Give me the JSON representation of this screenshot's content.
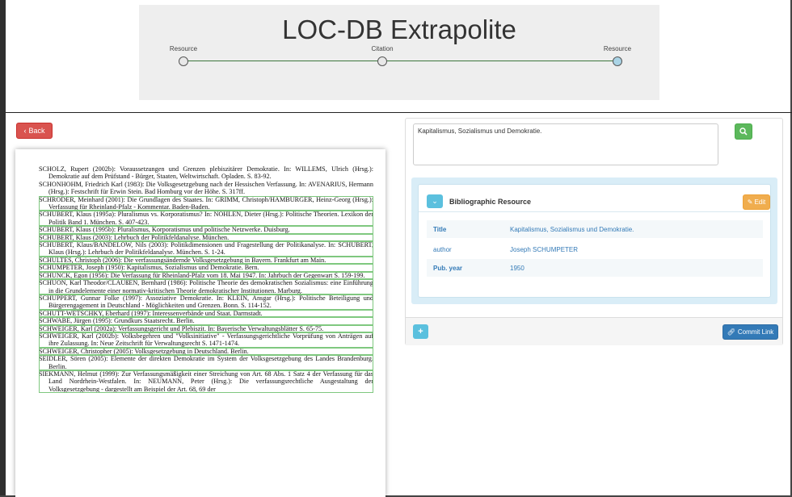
{
  "app": {
    "title": "LOC-DB Extrapolite"
  },
  "stepper": {
    "steps": [
      {
        "label": "Resource",
        "active": false
      },
      {
        "label": "Citation",
        "active": false
      },
      {
        "label": "Resource",
        "active": true
      }
    ]
  },
  "toolbar": {
    "back_label": "Back",
    "back_icon": "chevron-left"
  },
  "scan": {
    "references": [
      {
        "text": "SCHOLZ, Rupert (2002b): Voraussetzungen und Grenzen plebiszitärer Demokratie. In: WILLEMS, Ulrich (Hrsg.): Demokratie auf dem Prüfstand - Bürger, Staaten, Weltwirtschaft. Opladen. S. 83-92.",
        "highlighted": false
      },
      {
        "text": "SCHONHOHM, Friedrich Karl (1983): Die Volksgesetzgebung nach der Hessischen Verfassung. In: AVENARIUS, Hermann (Hrsg.): Festschrift für Erwin Stein. Bad Homburg vor der Höhe. S. 317ff.",
        "highlighted": false
      },
      {
        "text": "SCHRÖDER, Meinhard (2001): Die Grundlagen des Staates. In: GRIMM, Christoph/HAMBURGER, Heinz-Georg (Hrsg.): Verfassung für Rheinland-Pfalz - Kommentar. Baden-Baden.",
        "highlighted": true
      },
      {
        "text": "SCHUBERT, Klaus (1995a): Pluralismus vs. Korporatismus? In: NOHLEN, Dieter (Hrsg.): Politische Theorien. Lexikon der Politik Band 1. München. S. 407-423.",
        "highlighted": true
      },
      {
        "text": "SCHUBERT, Klaus (1995b): Pluralismus, Korporatismus und politische Netzwerke. Duisburg.",
        "highlighted": true
      },
      {
        "text": "SCHUBERT, Klaus (2003): Lehrbuch der Politikfeldanalyse. München.",
        "highlighted": true
      },
      {
        "text": "SCHUBERT, Klaus/BANDELOW, Nils (2003): Politikdimensionen und Fragestellung der Politikanalyse. In: SCHUBERT, Klaus (Hrsg.): Lehrbuch der Politikfeldanalyse. München. S. 1-24.",
        "highlighted": true
      },
      {
        "text": "SCHULTES, Christoph (2006): Die verfassungsändernde Volksgesetzgebung in Bayern. Frankfurt am Main.",
        "highlighted": true
      },
      {
        "text": "SCHUMPETER, Joseph (1950): Kapitalismus, Sozialismus und Demokratie. Bern.",
        "highlighted": true
      },
      {
        "text": "SCHUNCK, Egon (1956): Die Verfassung für Rheinland-Pfalz vom 18. Mai 1947. In: Jahrbuch der Gegenwart S. 159-199.",
        "highlighted": true
      },
      {
        "text": "SCHUON, Karl Theodor/CLAUßEN, Bernhard (1986): Politische Theorie des demokratischen Sozialismus: eine Einführung in die Grundelemente einer normativ-kritischen Theorie demokratischer Institutionen. Marburg.",
        "highlighted": true
      },
      {
        "text": "SCHUPPERT, Gunnar Folke (1997): Assoziative Demokratie. In: KLEIN, Ansgar (Hrsg.): Politische Beteiligung und Bürgerengagement in Deutschland - Möglichkeiten und Grenzen. Bonn. S. 114-152.",
        "highlighted": true
      },
      {
        "text": "SCHÜTT-WETSCHKY, Eberhard (1997): Interessenverbände und Staat. Darmstadt.",
        "highlighted": true
      },
      {
        "text": "SCHWABE, Jürgen (1995): Grundkurs Staatsrecht. Berlin.",
        "highlighted": true
      },
      {
        "text": "SCHWEIGER, Karl (2002a): Verfassungsgericht und Plebiszit. In: Bayerische Verwaltungsblätter S. 65-75.",
        "highlighted": true
      },
      {
        "text": "SCHWEIGER, Karl (2002b): Volksbegehren und \"Volksinitiative\" - Verfassungsgerichtliche Vorprüfung von Anträgen auf ihre Zulassung. In: Neue Zeitschrift für Verwaltungsrecht S. 1471-1474.",
        "highlighted": true
      },
      {
        "text": "SCHWEIGER, Christopher (2005): Volksgesetzgebung in Deutschland. Berlin.",
        "highlighted": true
      },
      {
        "text": "SEIDLER, Sören (2005): Elemente der direkten Demokratie im System der Volksgesetzgebung des Landes Brandenburg. Berlin.",
        "highlighted": true
      },
      {
        "text": "SIEKMANN, Helmut (1999): Zur Verfassungsmäßigkeit einer Streichung von Art. 68 Abs. 1 Satz 4 der Verfassung für das Land Nordrhein-Westfalen. In: NEUMANN, Peter (Hrsg.): Die verfassungsrechtliche Ausgestaltung der Volksgesetzgebung - dargestellt am Beispiel der Art. 68, 69 der",
        "highlighted": true
      }
    ]
  },
  "search": {
    "value": "Kapitalismus, Sozialismus und Demokratie.",
    "button_icon": "search"
  },
  "resource_card": {
    "title": "Bibliographic Resource",
    "toggle_icon": "chevron-down",
    "edit_label": "Edit",
    "edit_icon": "pencil-square",
    "properties": [
      {
        "key": "Title",
        "value": "Kapitalismus, Sozialismus und Demokratie."
      },
      {
        "key": "author",
        "value": "Joseph SCHUMPETER"
      },
      {
        "key": "Pub. year",
        "value": "1950"
      }
    ]
  },
  "footer": {
    "plus_label": "+",
    "commit_label": "Commit Link",
    "commit_icon": "link"
  },
  "colors": {
    "danger": "#d9534f",
    "success": "#5cb85c",
    "info": "#5bc0de",
    "warning": "#f0ad4e",
    "primary": "#337ab7",
    "highlight": "#7fc87f"
  }
}
